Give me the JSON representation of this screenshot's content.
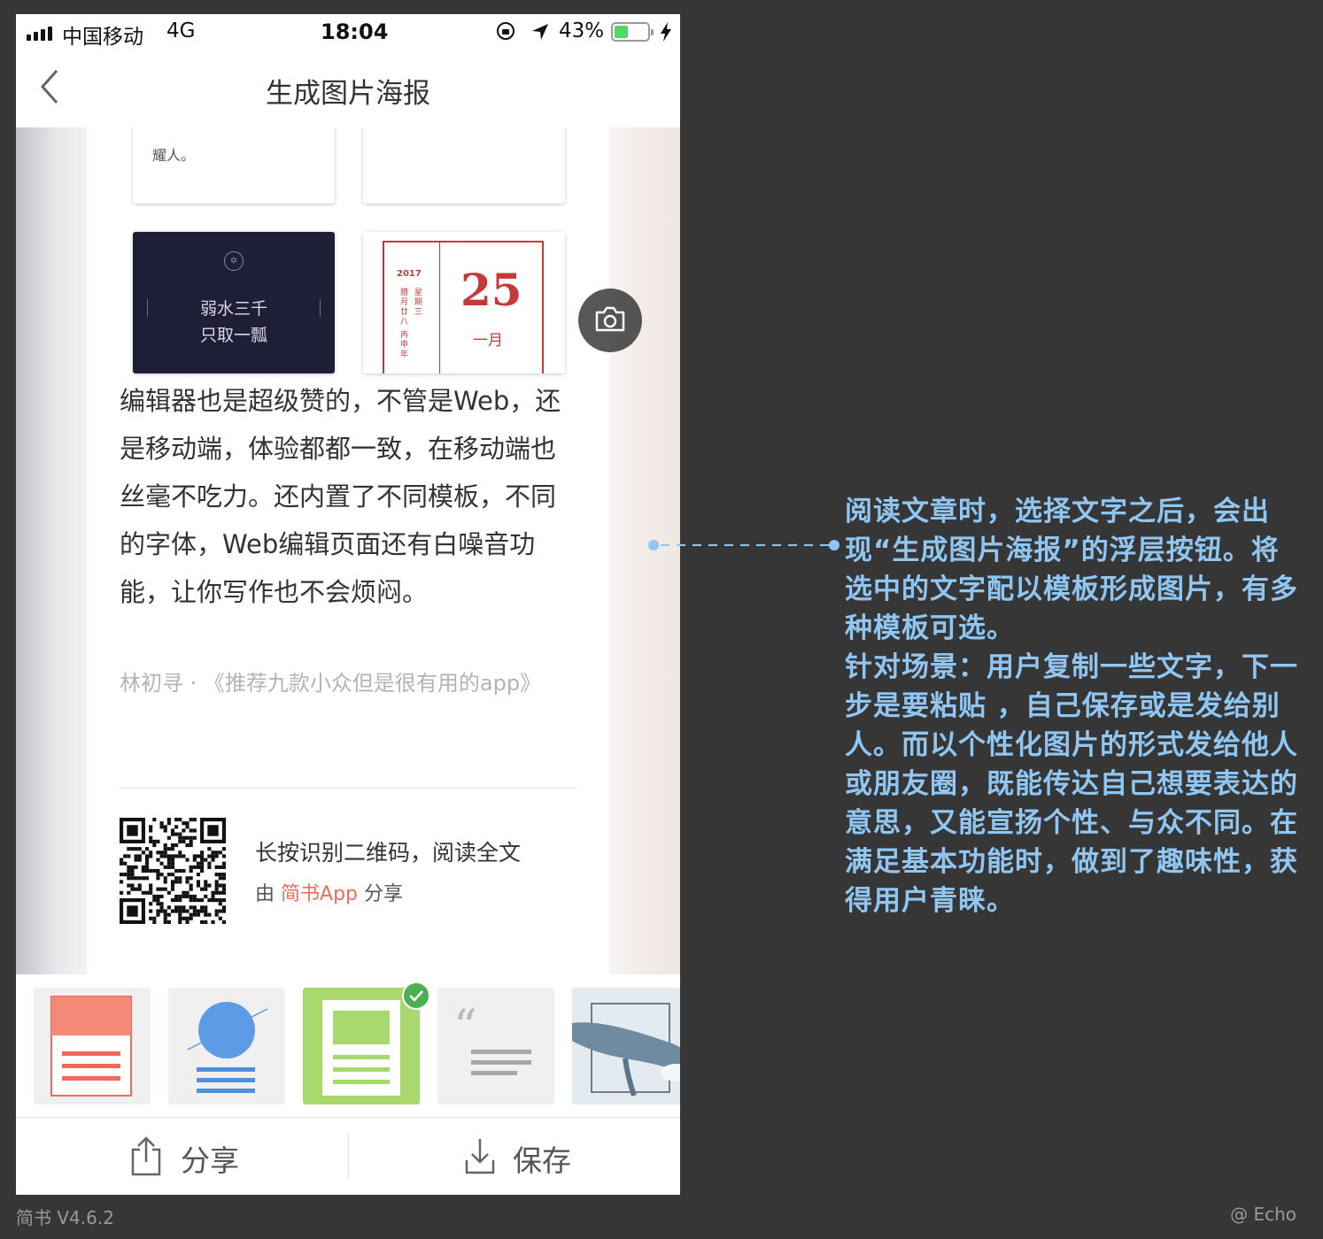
{
  "status_bar": {
    "carrier": "中国移动",
    "network": "4G",
    "time": "18:04",
    "battery_percent": "43%",
    "battery_level": 0.43,
    "icons": [
      "signal-icon",
      "orientation-lock-icon",
      "location-arrow-icon",
      "battery-icon",
      "charging-bolt-icon"
    ]
  },
  "nav": {
    "title": "生成图片海报",
    "back_icon": "chevron-left-icon"
  },
  "poster": {
    "template_cards": {
      "top_left_text": "耀人。",
      "dark_card_line1": "弱水三千",
      "dark_card_line2": "只取一瓢",
      "calendar_year": "2017",
      "calendar_col1": "星期三",
      "calendar_col2": "腊月廿八",
      "calendar_col3": "丙申年",
      "calendar_day": "25",
      "calendar_month": "一月"
    },
    "quote": "编辑器也是超级赞的，不管是Web，还是移动端，体验都都一致，在移动端也丝毫不吃力。还内置了不同模板，不同的字体，Web编辑页面还有白噪音功能，让你写作也不会烦闷。",
    "source": "林初寻 · 《推荐九款小众但是很有用的app》",
    "qr_hint": "长按识别二维码，阅读全文",
    "share_prefix": "由",
    "share_app": "简书App",
    "share_suffix": "分享"
  },
  "camera_button_icon": "camera-icon",
  "templates": {
    "selected_index": 2,
    "items": [
      "template-red-icon",
      "template-blue-circle-icon",
      "template-green-icon",
      "template-quote-icon",
      "template-whale-photo-icon"
    ]
  },
  "actions": {
    "share_label": "分享",
    "save_label": "保存"
  },
  "annotation": {
    "text": "阅读文章时，选择文字之后，会出现“生成图片海报”的浮层按钮。将选中的文字配以模板形成图片，有多种模板可选。\n针对场景：用户复制一些文字，下一步是要粘贴 ，自己保存或是发给别人。而以个性化图片的形式发给他人或朋友圈，既能传达自己想要表达的意思，又能宣扬个性、与众不同。在满足基本功能时，做到了趣味性，获得用户青睐。"
  },
  "footer": {
    "version": "简书 V4.6.2",
    "author": "@ Echo"
  },
  "colors": {
    "background": "#363636",
    "annotation": "#90c6f2",
    "accent": "#ea6f5a",
    "selected_check": "#4cb050",
    "template_green": "#a8d86e"
  }
}
